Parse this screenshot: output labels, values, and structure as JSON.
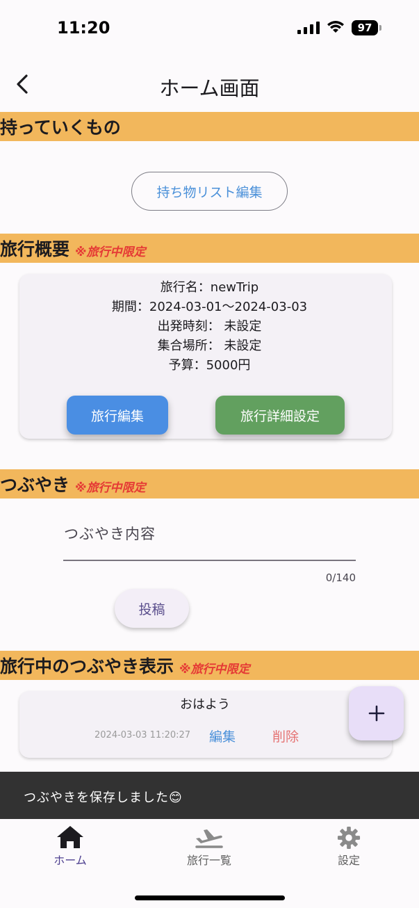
{
  "status_bar": {
    "time": "11:20",
    "battery": "97"
  },
  "app_bar": {
    "title": "ホーム画面"
  },
  "belongings": {
    "title": "持っていくもの",
    "edit_list_label": "持ち物リスト編集"
  },
  "trip_overview": {
    "title": "旅行概要",
    "note": "※旅行中限定",
    "lines": [
      "旅行名：newTrip",
      "期間：2024-03-01〜2024-03-03",
      "出発時刻： 未設定",
      "集合場所： 未設定",
      "予算：5000円"
    ],
    "edit_trip_label": "旅行編集",
    "trip_detail_label": "旅行詳細設定"
  },
  "tweet": {
    "title": "つぶやき",
    "note": "※旅行中限定",
    "placeholder": "つぶやき内容",
    "counter": "0/140",
    "post_label": "投稿"
  },
  "tweet_list": {
    "title": "旅行中のつぶやき表示",
    "note": "※旅行中限定",
    "items": [
      {
        "text": "おはよう",
        "timestamp": "2024-03-03 11:20:27",
        "edit_label": "編集",
        "delete_label": "削除"
      }
    ]
  },
  "snackbar": {
    "message": "つぶやきを保存しました😊"
  },
  "bottom_nav": {
    "items": [
      {
        "label": "ホーム",
        "icon": "home-icon",
        "active": true
      },
      {
        "label": "旅行一覧",
        "icon": "airplane-icon",
        "active": false
      },
      {
        "label": "設定",
        "icon": "gear-icon",
        "active": false
      }
    ]
  },
  "colors": {
    "section_header": "#f2b75c",
    "note_red": "#e53935",
    "accent_blue": "#4a90d9",
    "button_green": "#62a05f",
    "active_nav": "#4d3f8f"
  }
}
